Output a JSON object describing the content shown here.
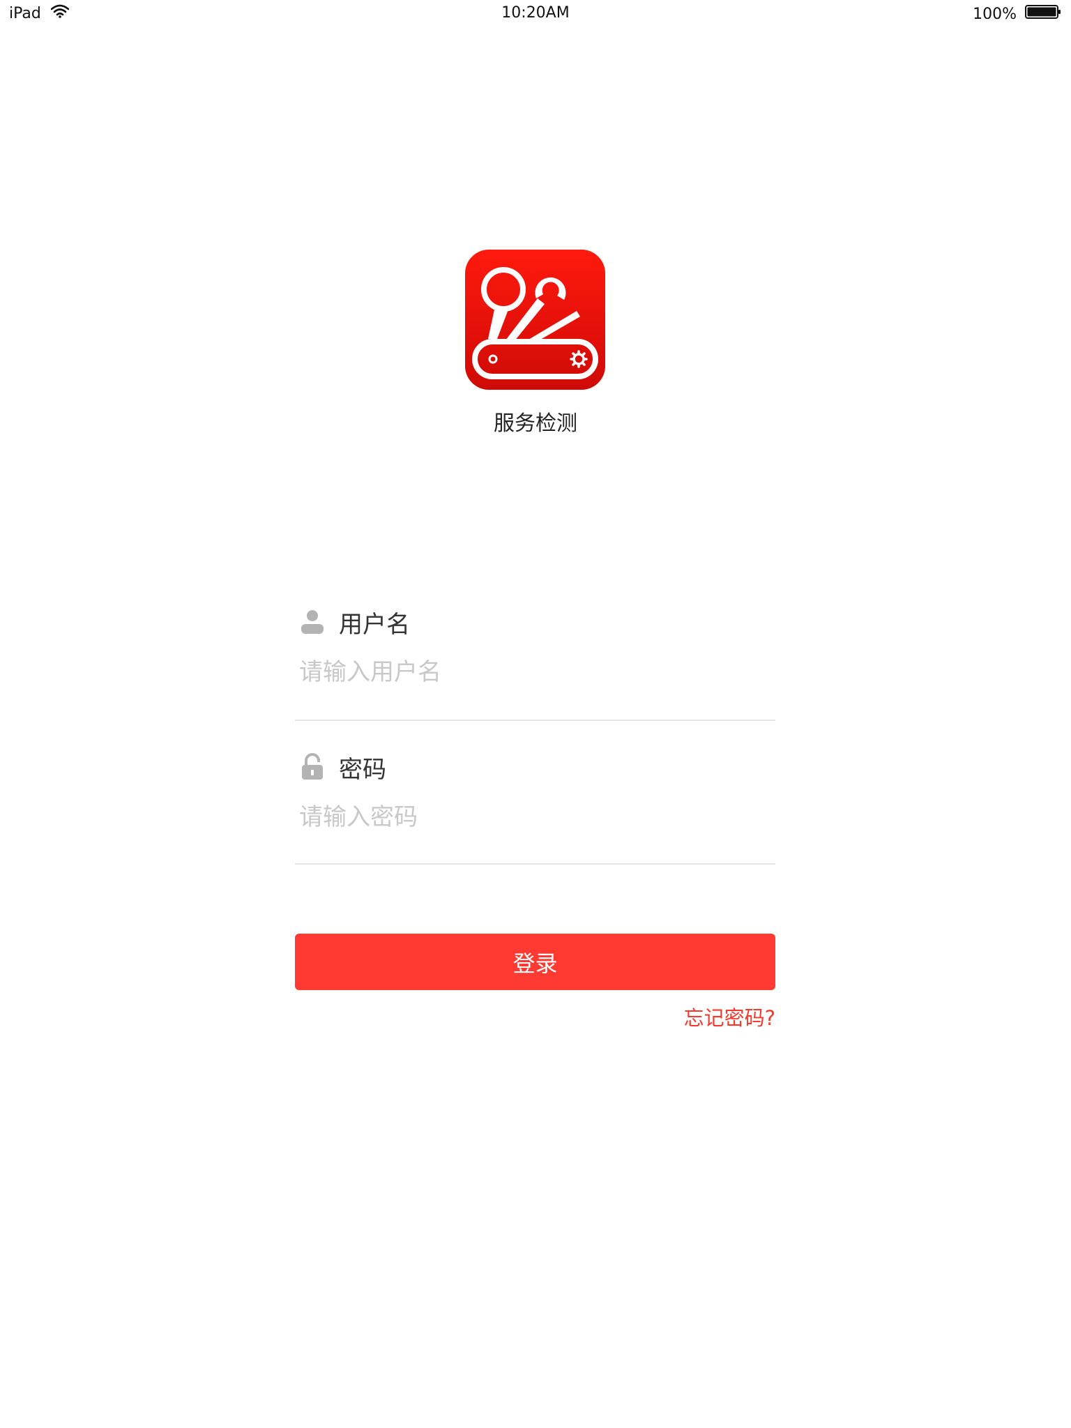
{
  "status_bar": {
    "device": "iPad",
    "time": "10:20AM",
    "battery": "100%"
  },
  "app": {
    "name": "服务检测",
    "icon": "service-tools-icon"
  },
  "form": {
    "username": {
      "label": "用户名",
      "placeholder": "请输入用户名",
      "value": "",
      "icon": "user-icon"
    },
    "password": {
      "label": "密码",
      "placeholder": "请输入密码",
      "value": "",
      "icon": "lock-icon"
    },
    "login_label": "登录",
    "forgot_label": "忘记密码?"
  },
  "colors": {
    "accent": "#ff3a33",
    "link": "#f23b2e",
    "icon_red": "#e8120c",
    "placeholder": "#c8c8c8"
  }
}
